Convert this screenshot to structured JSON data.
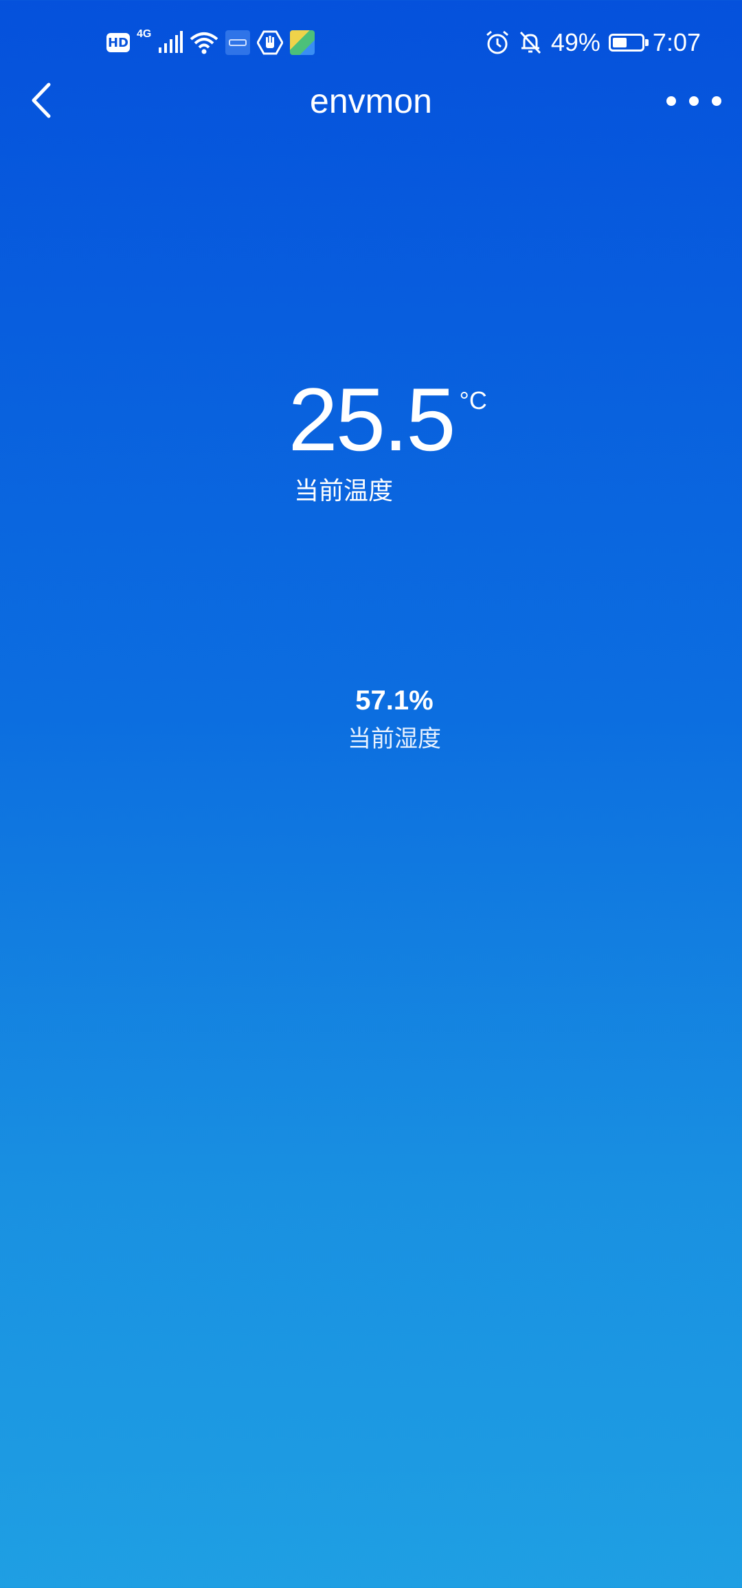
{
  "status_bar": {
    "hd_label": "HD",
    "network_type": "4G",
    "battery_percent": "49%",
    "battery_level": 0.49,
    "time": "7:07",
    "icons_left": [
      "hd-icon",
      "network-4g-icon",
      "signal-icon",
      "wifi-icon",
      "app-notification-icon",
      "hand-icon",
      "map-app-icon"
    ],
    "icons_right": [
      "alarm-icon",
      "bell-off-icon",
      "battery-icon"
    ]
  },
  "header": {
    "title": "envmon",
    "back_icon": "back-arrow-icon",
    "more_icon": "more-dots-icon"
  },
  "temperature": {
    "value": "25.5",
    "unit": "°C",
    "label": "当前温度"
  },
  "humidity": {
    "value": "57.1%",
    "label": "当前湿度"
  },
  "colors": {
    "gradient_top": "#0551dc",
    "gradient_bottom": "#1f9fe3",
    "text": "#ffffff"
  }
}
